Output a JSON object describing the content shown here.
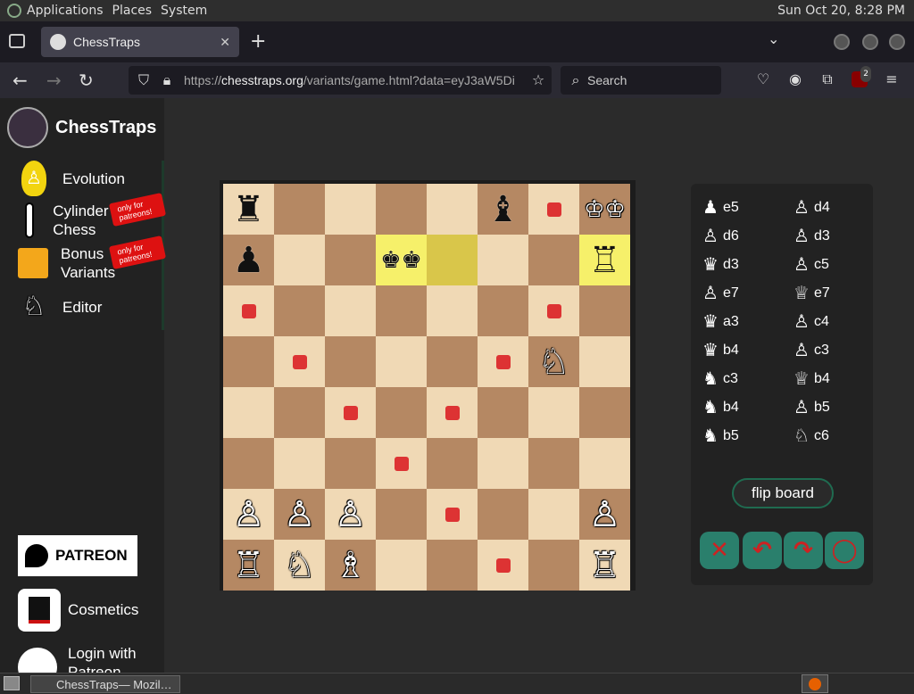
{
  "os": {
    "menu": [
      "Applications",
      "Places",
      "System"
    ],
    "clock": "Sun Oct 20,  8:28 PM"
  },
  "browser": {
    "tab_title": "ChessTraps",
    "url_domain": "chesstraps.org",
    "url_prefix": "https://",
    "url_path": "/variants/game.html?data=eyJ3aW5Di",
    "search_placeholder": "Search",
    "extension_badge": "2"
  },
  "site": {
    "brand": "ChessTraps",
    "nav": [
      {
        "label": "Evolution"
      },
      {
        "label": "Cylinder Chess"
      },
      {
        "label": "Bonus Variants"
      },
      {
        "label": "Editor"
      }
    ],
    "ribbon": "only for patreons!",
    "patreon": "PATREON",
    "cosmetics": "Cosmetics",
    "login": "Login with Patreon"
  },
  "board": {
    "colors": {
      "light": "#f0d9b5",
      "dark": "#b58863",
      "highlight": "#f6f06a",
      "dot": "#d33333"
    },
    "rows": [
      [
        {
          "p": "♜",
          "c": "red"
        },
        {},
        {},
        {},
        {},
        {
          "p": "♝",
          "c": "b"
        },
        {
          "dot": true
        },
        {
          "p": "♔♔",
          "c": "w"
        }
      ],
      [
        {
          "p": "♟",
          "c": "b"
        },
        {},
        {},
        {
          "p": "♚♚",
          "c": "b",
          "hl": true
        },
        {
          "hl2": true
        },
        {},
        {},
        {
          "p": "♖",
          "c": "red",
          "hl": true
        }
      ],
      [
        {
          "dot": true
        },
        {},
        {},
        {},
        {},
        {},
        {
          "dot": true
        },
        {}
      ],
      [
        {},
        {
          "dot": true
        },
        {},
        {},
        {},
        {
          "dot": true
        },
        {
          "p": "♘",
          "c": "w"
        },
        {}
      ],
      [
        {},
        {},
        {
          "dot": true
        },
        {},
        {
          "dot": true
        },
        {},
        {},
        {}
      ],
      [
        {},
        {},
        {},
        {
          "dot": true
        },
        {},
        {},
        {},
        {}
      ],
      [
        {
          "p": "♙",
          "c": "w"
        },
        {
          "p": "♙",
          "c": "w"
        },
        {
          "p": "♙",
          "c": "w"
        },
        {},
        {
          "dot": true
        },
        {},
        {},
        {
          "p": "♙",
          "c": "w"
        }
      ],
      [
        {
          "p": "♖",
          "c": "w"
        },
        {
          "p": "♘",
          "c": "w"
        },
        {
          "p": "♗",
          "c": "w"
        },
        {},
        {},
        {
          "dot": true
        },
        {},
        {
          "p": "♖",
          "c": "w"
        }
      ]
    ]
  },
  "moves": [
    {
      "l": "♟",
      "lt": "e5",
      "r": "♙",
      "rt": "d4",
      "eq_l": "=",
      "eq_r": ""
    },
    {
      "l": "♙",
      "lt": "d6",
      "r": "♙",
      "rt": "d3"
    },
    {
      "l": "♛",
      "lt": "d3",
      "r": "♙",
      "rt": "c5"
    },
    {
      "l": "♙",
      "lt": "e7",
      "r": "♕",
      "rt": "e7"
    },
    {
      "l": "♛",
      "lt": "a3",
      "r": "♙",
      "rt": "c4"
    },
    {
      "l": "♛",
      "lt": "b4",
      "r": "♙",
      "rt": "c3"
    },
    {
      "l": "♞",
      "lt": "c3",
      "r": "♕",
      "rt": "b4"
    },
    {
      "l": "♞",
      "lt": "b4",
      "r": "♙",
      "rt": "b5"
    },
    {
      "l": "♞",
      "lt": "b5",
      "r": "♘",
      "rt": "c6"
    }
  ],
  "panel": {
    "flip_label": "flip board"
  }
}
